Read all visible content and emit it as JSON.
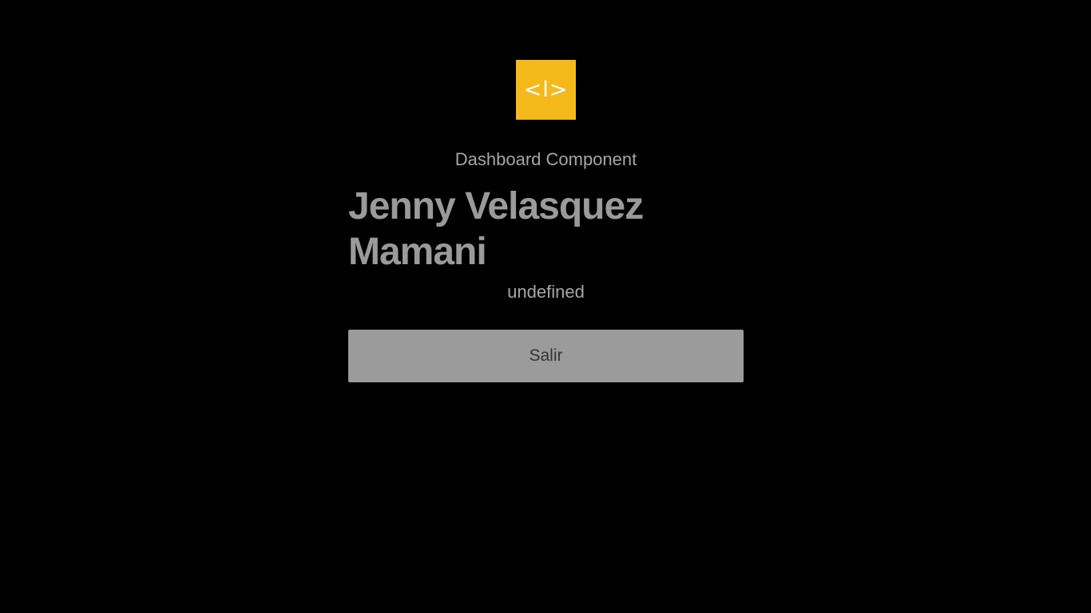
{
  "logo": {
    "glyph": "<l>",
    "icon": "code-brackets-icon",
    "color": "#f6b91c"
  },
  "dashboard": {
    "title": "Dashboard Component",
    "user_name": "Jenny Velasquez Mamani",
    "user_role": "undefined",
    "logout_label": "Salir"
  },
  "colors": {
    "background": "#000000",
    "text_muted": "#a6a6a6",
    "button_bg": "#9b9b9b"
  }
}
